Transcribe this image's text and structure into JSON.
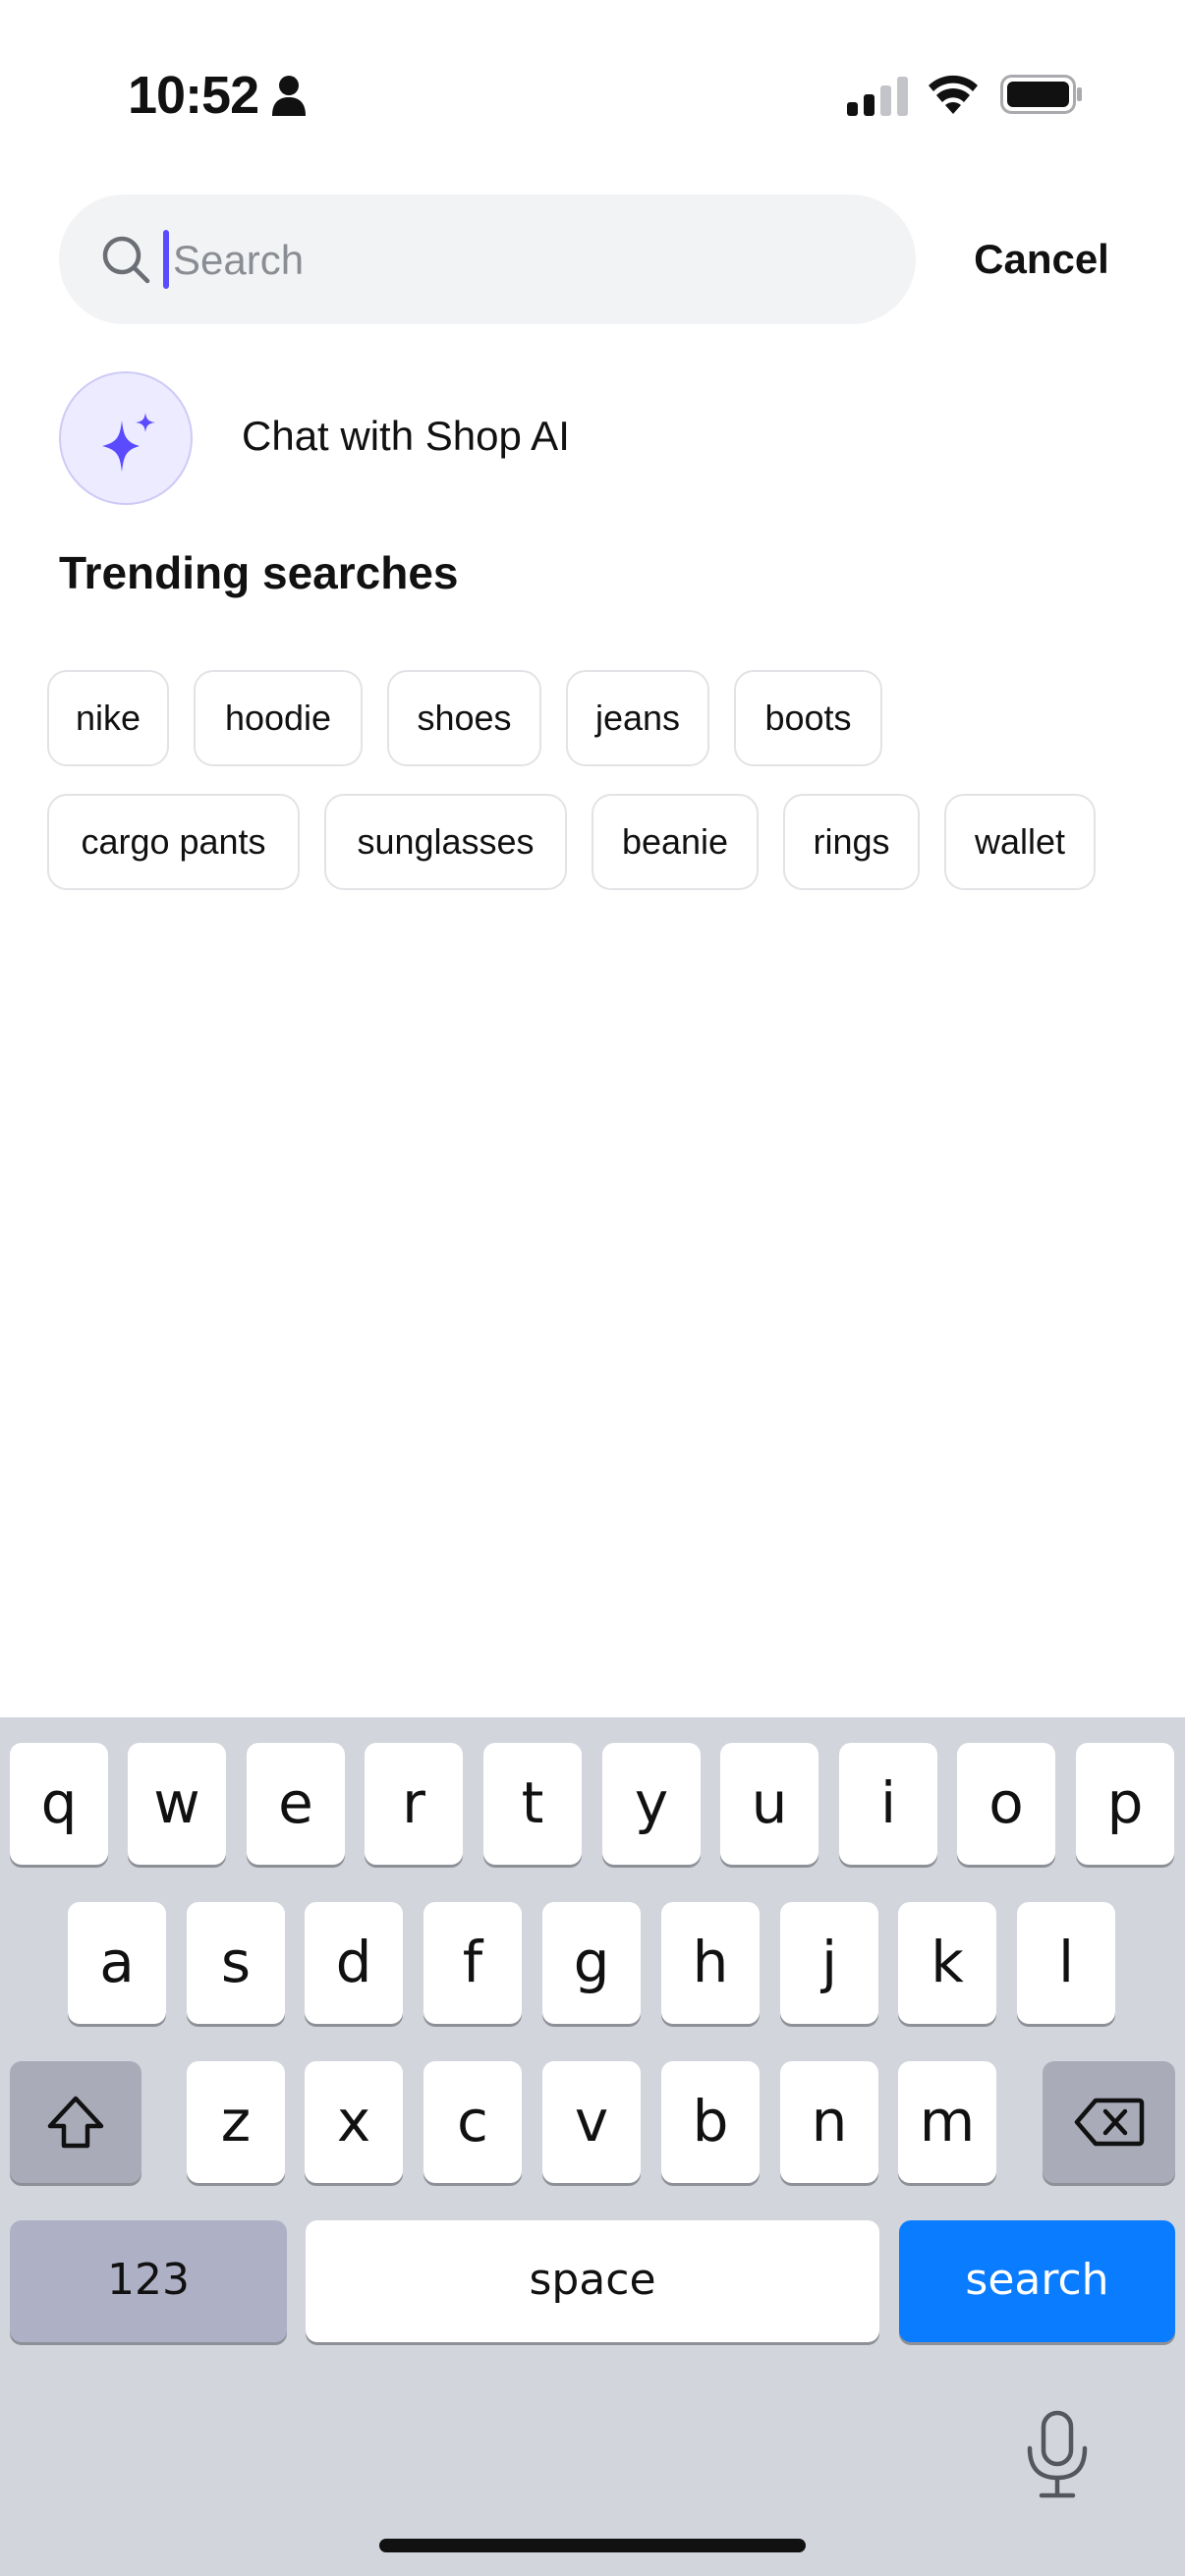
{
  "status_bar": {
    "time": "10:52"
  },
  "search": {
    "placeholder": "Search",
    "value": "",
    "cancel_label": "Cancel"
  },
  "chat": {
    "label": "Chat with Shop AI"
  },
  "trending": {
    "title": "Trending searches",
    "chips": [
      "nike",
      "hoodie",
      "shoes",
      "jeans",
      "boots",
      "cargo pants",
      "sunglasses",
      "beanie",
      "rings",
      "wallet"
    ]
  },
  "keyboard": {
    "row1": [
      "q",
      "w",
      "e",
      "r",
      "t",
      "y",
      "u",
      "i",
      "o",
      "p"
    ],
    "row2": [
      "a",
      "s",
      "d",
      "f",
      "g",
      "h",
      "j",
      "k",
      "l"
    ],
    "row3": [
      "z",
      "x",
      "c",
      "v",
      "b",
      "n",
      "m"
    ],
    "numbers_label": "123",
    "space_label": "space",
    "search_label": "search"
  },
  "colors": {
    "accent": "#5a4bff",
    "search_key": "#0a7cff",
    "keyboard_bg": "#d3d5dd"
  },
  "icons": [
    "person-icon",
    "signal-icon",
    "wifi-icon",
    "battery-icon",
    "search-icon",
    "sparkle-icon",
    "shift-icon",
    "backspace-icon",
    "mic-icon"
  ]
}
